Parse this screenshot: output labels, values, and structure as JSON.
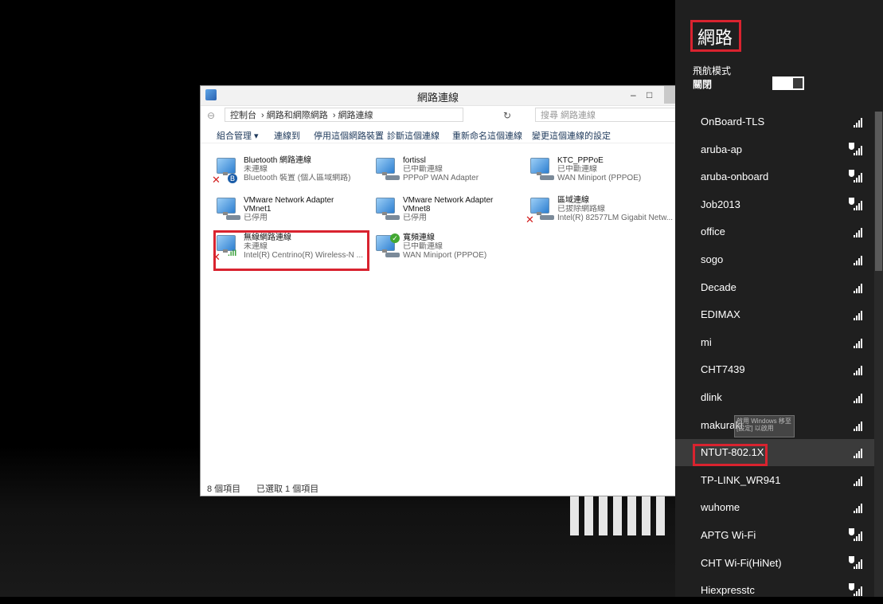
{
  "window": {
    "title": "網路連線",
    "addr_crumbs": [
      "控制台",
      "網路和網際網路",
      "網路連線"
    ],
    "search_placeholder": "搜尋 網路連線",
    "commands": [
      "組合管理 ▾",
      "連線到",
      "停用這個網路裝置",
      "診斷這個連線",
      "重新命名這個連線",
      "變更這個連線的設定"
    ],
    "connections": [
      {
        "name": "Bluetooth 網路連線",
        "status": "未連線",
        "device": "Bluetooth 裝置 (個人區域網路)",
        "icon": "bluetooth-adapter-icon"
      },
      {
        "name": "fortissl",
        "status": "已中斷連線",
        "device": "PPPoP WAN Adapter",
        "icon": "vpn-adapter-icon"
      },
      {
        "name": "KTC_PPPoE",
        "status": "已中斷連線",
        "device": "WAN Miniport (PPPOE)",
        "icon": "pppoe-adapter-icon"
      },
      {
        "name": "VMware Network Adapter",
        "name2": "VMnet1",
        "status": "已停用",
        "icon": "ethernet-adapter-icon"
      },
      {
        "name": "VMware Network Adapter",
        "name2": "VMnet8",
        "status": "已停用",
        "icon": "ethernet-adapter-icon"
      },
      {
        "name": "區域連線",
        "status": "已拔除網路線",
        "device": "Intel(R) 82577LM Gigabit Netw...",
        "icon": "ethernet-adapter-icon"
      },
      {
        "name": "無線網路連線",
        "status": "未連線",
        "device": "Intel(R) Centrino(R) Wireless-N ...",
        "icon": "wifi-adapter-icon"
      },
      {
        "name": "寬頻連線",
        "status": "已中斷連線",
        "device": "WAN Miniport (PPPOE)",
        "icon": "broadband-adapter-icon"
      }
    ],
    "status_count": "8 個項目",
    "status_selected": "已選取 1 個項目"
  },
  "panel": {
    "title": "網路",
    "airplane_label": "飛航模式",
    "airplane_state": "關閉",
    "tooltip": "啟用 Windows 移至 [設定] 以啟用",
    "networks": [
      {
        "name": "OnBoard-TLS",
        "secured": false
      },
      {
        "name": "aruba-ap",
        "secured": true
      },
      {
        "name": "aruba-onboard",
        "secured": true
      },
      {
        "name": "Job2013",
        "secured": true
      },
      {
        "name": "office",
        "secured": false
      },
      {
        "name": "sogo",
        "secured": false
      },
      {
        "name": "Decade",
        "secured": false
      },
      {
        "name": "EDIMAX",
        "secured": false
      },
      {
        "name": "mi",
        "secured": false
      },
      {
        "name": "CHT7439",
        "secured": false
      },
      {
        "name": "dlink",
        "secured": false
      },
      {
        "name": "makuraki",
        "secured": false
      },
      {
        "name": "NTUT-802.1X",
        "secured": false,
        "selected": true
      },
      {
        "name": "TP-LINK_WR941",
        "secured": false
      },
      {
        "name": "wuhome",
        "secured": false
      },
      {
        "name": "APTG Wi-Fi",
        "secured": true
      },
      {
        "name": "CHT Wi-Fi(HiNet)",
        "secured": true
      },
      {
        "name": "Hiexpresstc",
        "secured": true
      }
    ]
  }
}
